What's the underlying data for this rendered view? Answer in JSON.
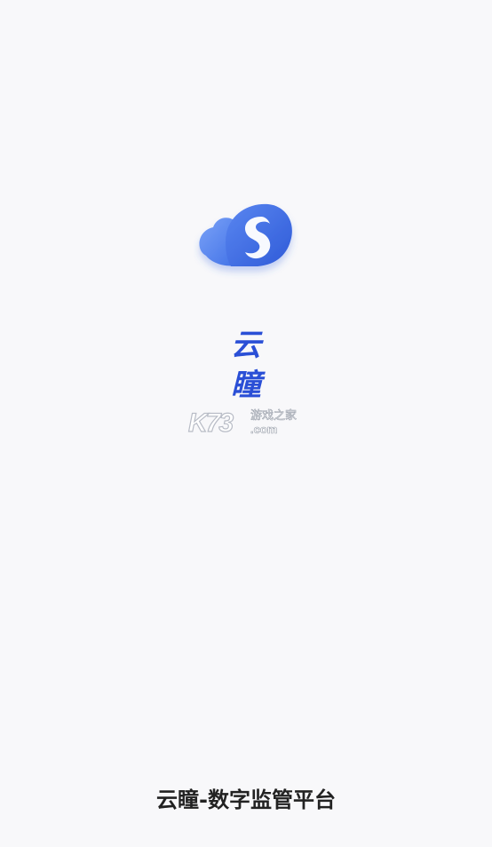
{
  "app": {
    "name_line1": "云",
    "name_line2": "瞳",
    "footer_title": "云瞳-数字监管平台",
    "brand_color": "#3a68e0",
    "logo_icon": "cloud-swirl-logo-icon"
  },
  "watermark": {
    "brand": "K73",
    "text_cn": "游戏之家",
    "text_domain": ".com"
  }
}
